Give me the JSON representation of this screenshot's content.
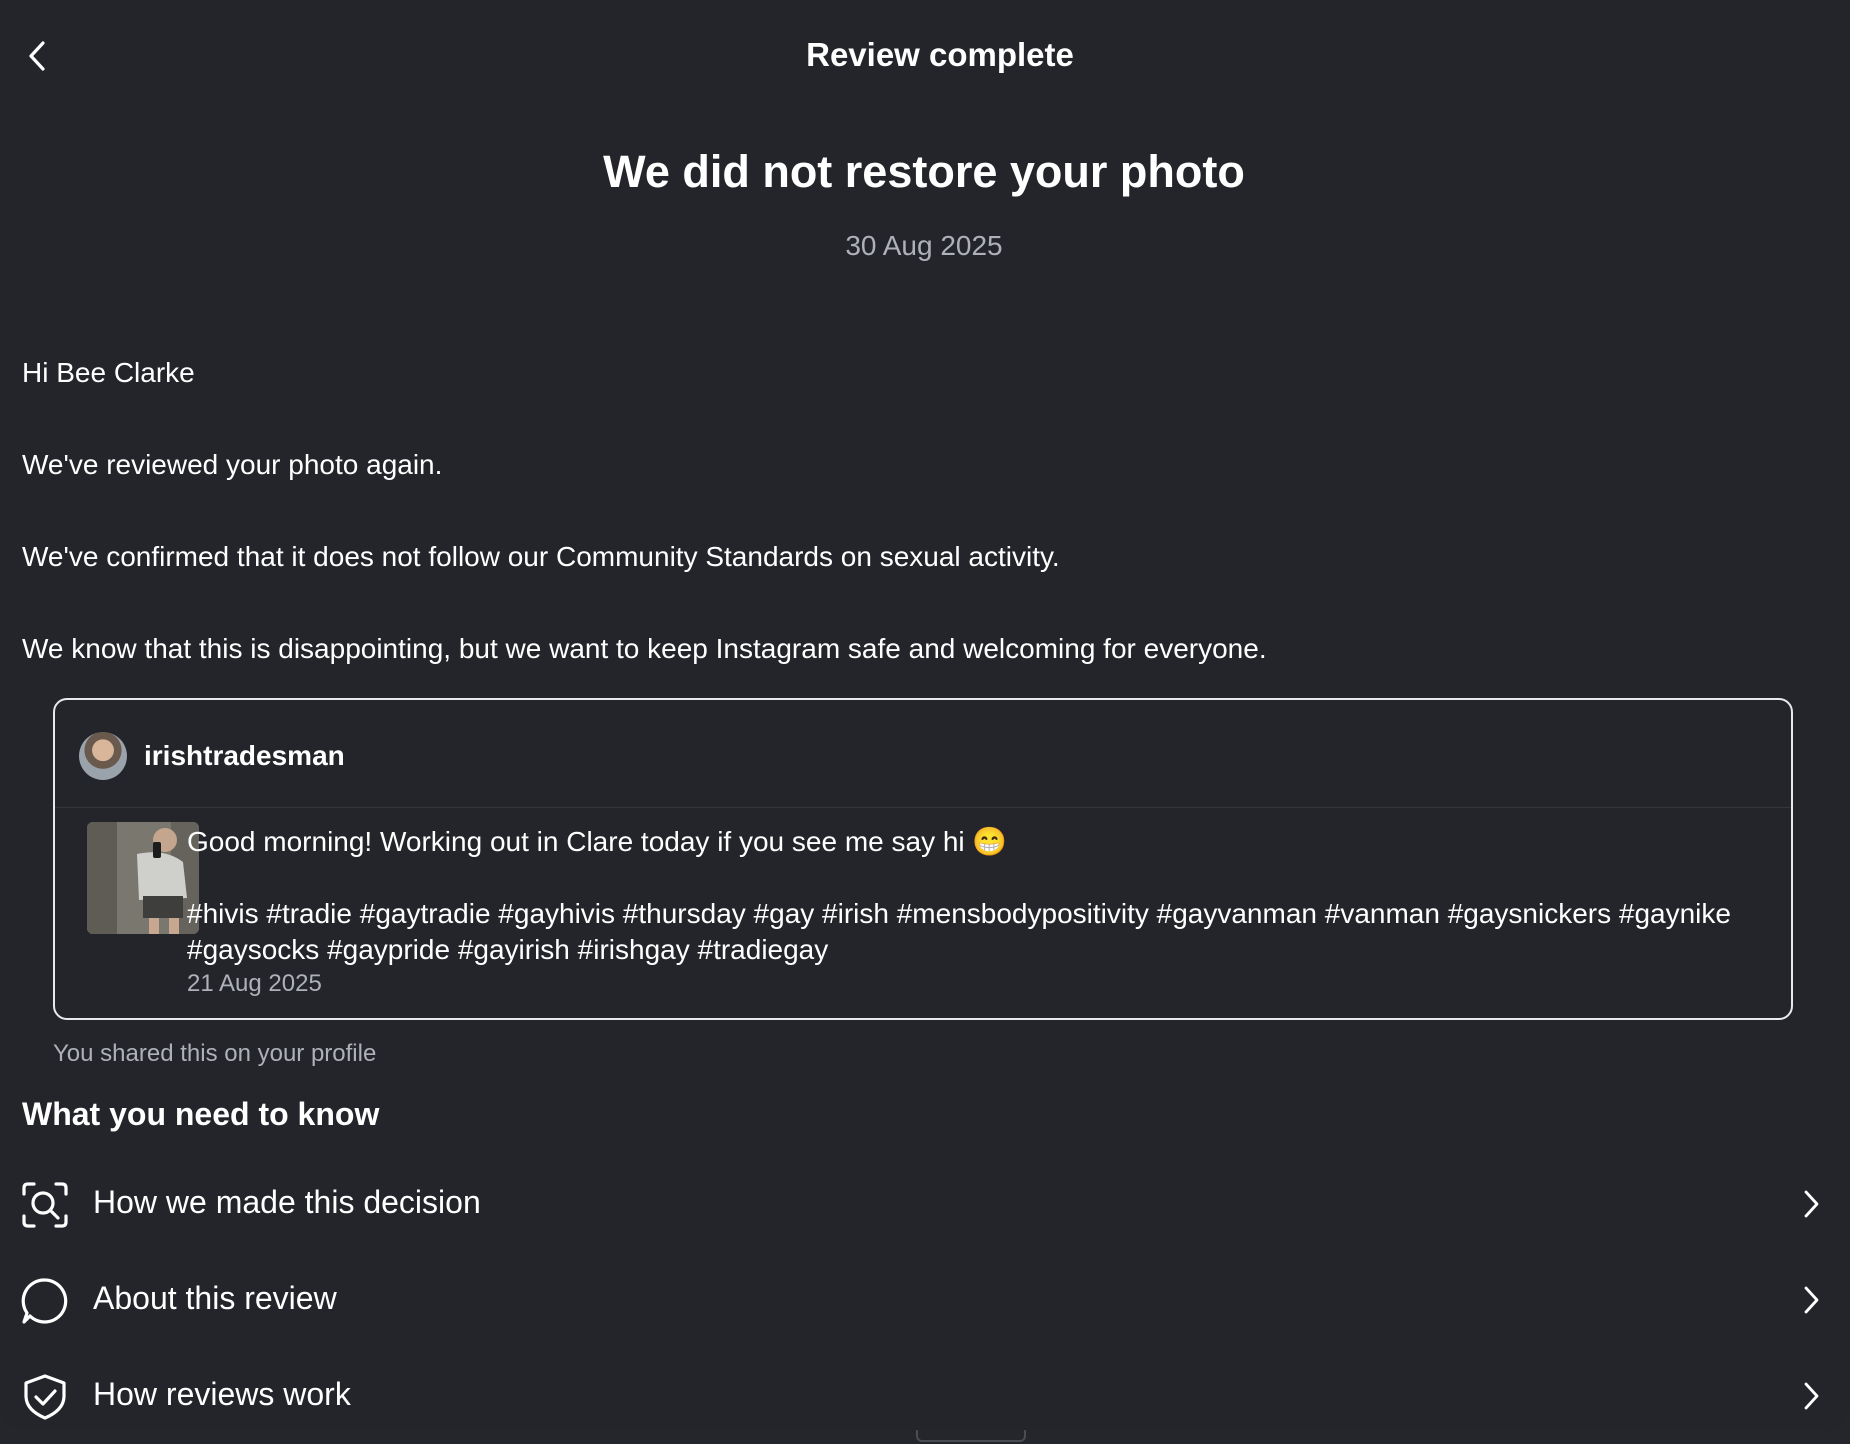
{
  "header": {
    "title": "Review complete",
    "back_icon": "chevron-left-icon"
  },
  "main": {
    "title": "We did not restore your photo",
    "date": "30 Aug 2025",
    "greeting": "Hi Bee Clarke",
    "paragraphs": [
      "We've reviewed your photo again.",
      "We've confirmed that it does not follow our Community Standards on sexual activity.",
      "We know that this is disappointing, but we want to keep Instagram safe and welcoming for everyone."
    ]
  },
  "post": {
    "username": "irishtradesman",
    "caption": "Good morning! Working out in Clare today if you see me say hi 😁",
    "hashtags": "#hivis #tradie #gaytradie #gayhivis #thursday #gay #irish #mensbodypositivity #gayvanman #vanman #gaysnickers #gaynike #gaysocks #gaypride #gayirish #irishgay #tradiegay",
    "date": "21 Aug 2025",
    "shared_note": "You shared this on your profile"
  },
  "info": {
    "heading": "What you need to know",
    "items": [
      {
        "label": "How we made this decision",
        "icon": "search-scan-icon"
      },
      {
        "label": "About this review",
        "icon": "speech-bubble-icon"
      },
      {
        "label": "How reviews work",
        "icon": "shield-check-icon"
      }
    ]
  },
  "colors": {
    "background": "#23252a",
    "text": "#ffffff",
    "muted": "#aeb1b7",
    "card_border": "#e8e9eb"
  }
}
